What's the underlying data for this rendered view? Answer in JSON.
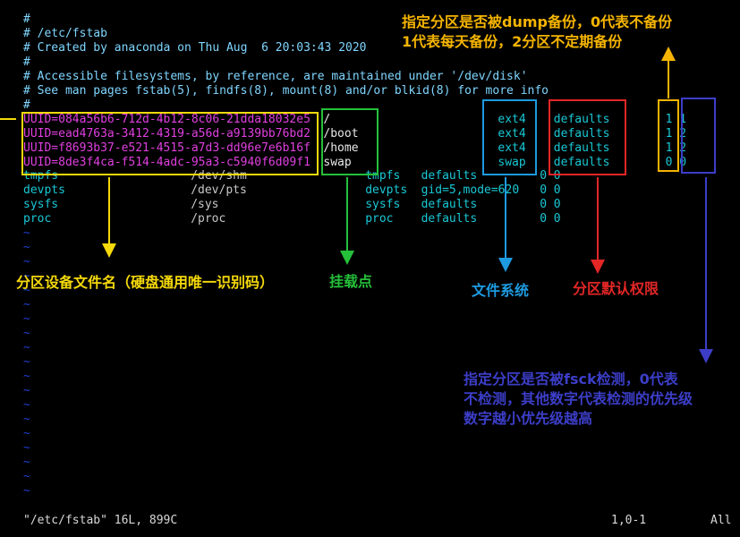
{
  "editor": {
    "comment_lines": [
      "#",
      "# /etc/fstab",
      "# Created by anaconda on Thu Aug  6 20:03:43 2020",
      "#",
      "# Accessible filesystems, by reference, are maintained under '/dev/disk'",
      "# See man pages fstab(5), findfs(8), mount(8) and/or blkid(8) for more info",
      "#"
    ],
    "entries": [
      {
        "device": "UUID=084a56b6-712d-4b12-8c06-21dda18032e5",
        "mount": "/",
        "type": "ext4",
        "options": "defaults",
        "dump": "1",
        "pass": "1"
      },
      {
        "device": "UUID=ead4763a-3412-4319-a56d-a9139bb76bd2",
        "mount": "/boot",
        "type": "ext4",
        "options": "defaults",
        "dump": "1",
        "pass": "2"
      },
      {
        "device": "UUID=f8693b37-e521-4515-a7d3-dd96e7e6b16f",
        "mount": "/home",
        "type": "ext4",
        "options": "defaults",
        "dump": "1",
        "pass": "2"
      },
      {
        "device": "UUID=8de3f4ca-f514-4adc-95a3-c5940f6d09f1",
        "mount": "swap",
        "type": "swap",
        "options": "defaults",
        "dump": "0",
        "pass": "0"
      }
    ],
    "other_entries": [
      {
        "device": "tmpfs",
        "mount": "/dev/shm",
        "type": "tmpfs",
        "options": "defaults",
        "dump": "0",
        "pass": "0"
      },
      {
        "device": "devpts",
        "mount": "/dev/pts",
        "type": "devpts",
        "options": "gid=5,mode=620",
        "dump": "0",
        "pass": "0"
      },
      {
        "device": "sysfs",
        "mount": "/sys",
        "type": "sysfs",
        "options": "defaults",
        "dump": "0",
        "pass": "0"
      },
      {
        "device": "proc",
        "mount": "/proc",
        "type": "proc",
        "options": "defaults",
        "dump": "0",
        "pass": "0"
      }
    ],
    "empty_line_marker": "~"
  },
  "status_bar": {
    "file_info": "\"/etc/fstab\" 16L, 899C",
    "cursor_position": "1,0-1",
    "scroll_position": "All"
  },
  "annotations": {
    "device": "分区设备文件名（硬盘通用唯一识别码）",
    "mount_point": "挂载点",
    "filesystem": "文件系统",
    "options": "分区默认权限",
    "dump": "指定分区是否被dump备份，0代表不备份\n1代表每天备份，2分区不定期备份",
    "fsck": "指定分区是否被fsck检测，0代表\n不检测，其他数字代表检测的优先级\n数字越小优先级越高"
  },
  "colors": {
    "device": "#f5d90a",
    "mount_point": "#25c03a",
    "filesystem": "#1e9be0",
    "options": "#e32626",
    "dump": "#f5b400",
    "fsck": "#3c3ec8"
  }
}
